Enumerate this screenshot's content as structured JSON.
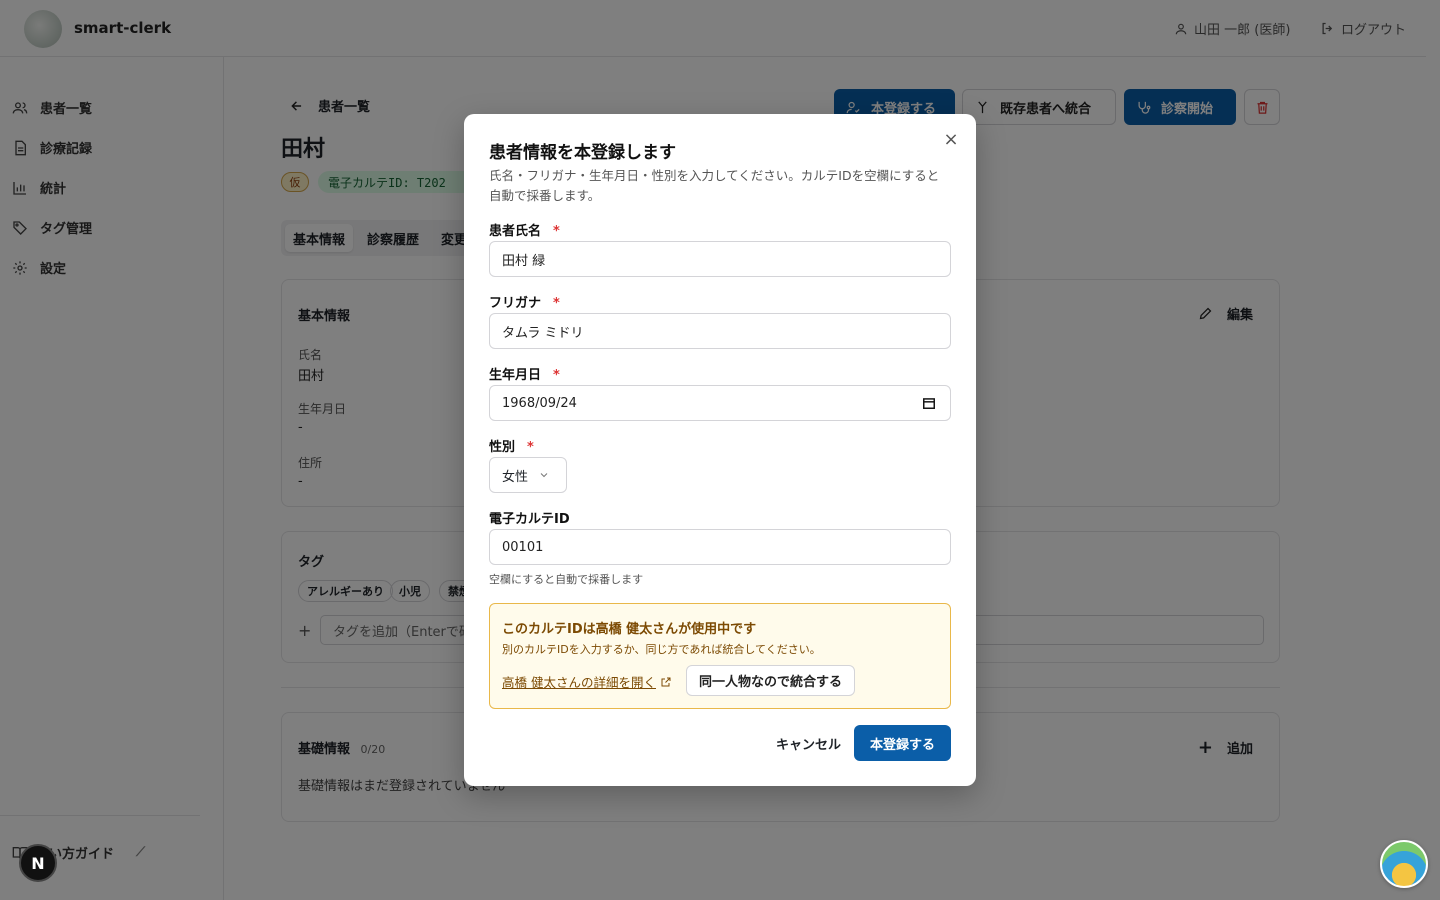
{
  "header": {
    "app_title": "smart-clerk",
    "user_label": "山田 一郎 (医師)",
    "logout_label": "ログアウト"
  },
  "sidebar": {
    "items": [
      {
        "label": "患者一覧",
        "icon": "users-icon"
      },
      {
        "label": "診療記録",
        "icon": "document-icon"
      },
      {
        "label": "統計",
        "icon": "chart-icon"
      },
      {
        "label": "タグ管理",
        "icon": "tag-icon"
      },
      {
        "label": "設定",
        "icon": "gear-icon"
      }
    ],
    "guide_label": "使い方ガイド"
  },
  "page": {
    "back_label": "患者一覧",
    "patient_name": "田村",
    "kari_badge": "仮",
    "karte_badge": "電子カルテID: T202",
    "tabs": [
      "基本情報",
      "診察履歴",
      "変更"
    ],
    "actions": {
      "register": "本登録する",
      "merge": "既存患者へ統合",
      "start_exam": "診察開始"
    },
    "basic_card": {
      "title": "基本情報",
      "edit_label": "編集",
      "fields": [
        {
          "label": "氏名",
          "value": "田村"
        },
        {
          "label": "生年月日",
          "value": "-"
        },
        {
          "label": "住所",
          "value": "-"
        }
      ]
    },
    "tag_card": {
      "title": "タグ",
      "tags": [
        "アレルギーあり",
        "小児",
        "禁煙"
      ],
      "input_placeholder": "タグを追加（Enterで確"
    },
    "foundation_card": {
      "title": "基礎情報",
      "count": "0/20",
      "add_label": "追加",
      "empty_text": "基礎情報はまだ登録されていません"
    }
  },
  "modal": {
    "title": "患者情報を本登録します",
    "description": "氏名・フリガナ・生年月日・性別を入力してください。カルテIDを空欄にすると自動で採番します。",
    "fields": {
      "name": {
        "label": "患者氏名",
        "value": "田村 緑"
      },
      "kana": {
        "label": "フリガナ",
        "value": "タムラ ミドリ"
      },
      "birth": {
        "label": "生年月日",
        "value": "1968/09/24"
      },
      "gender": {
        "label": "性別",
        "value": "女性"
      },
      "karte_id": {
        "label": "電子カルテID",
        "value": "00101",
        "help": "空欄にすると自動で採番します"
      }
    },
    "warning": {
      "title": "このカルテIDは高橋 健太さんが使用中です",
      "subtitle": "別のカルテIDを入力するか、同じ方であれば統合してください。",
      "link": "高橋 健太さんの詳細を開く",
      "merge_button": "同一人物なので統合する"
    },
    "cancel_label": "キャンセル",
    "submit_label": "本登録する"
  },
  "colors": {
    "primary": "#0b5ea8",
    "warning_bg": "#fffbeb",
    "warning_border": "#e9b84a",
    "required": "#dd3333"
  }
}
